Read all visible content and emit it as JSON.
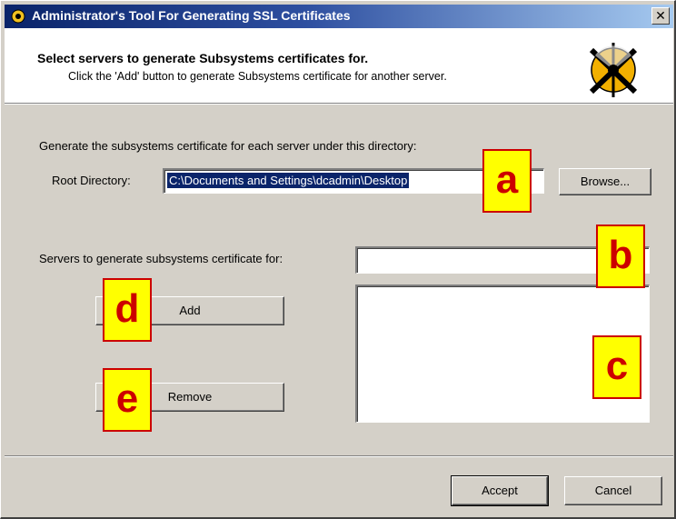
{
  "window": {
    "title": "Administrator's Tool For Generating SSL Certificates",
    "close_glyph": "✕"
  },
  "header": {
    "title": "Select servers to generate Subsystems certificates for.",
    "subtitle": "Click the 'Add' button to generate Subsystems certificate for another server."
  },
  "form": {
    "directory_instruction": "Generate the subsystems certificate for each server under this directory:",
    "root_directory_label": "Root Directory:",
    "root_directory_value": "C:\\Documents and Settings\\dcadmin\\Desktop",
    "browse_label": "Browse...",
    "servers_label": "Servers to generate subsystems certificate for:",
    "server_name_value": "",
    "add_label": "Add",
    "remove_label": "Remove",
    "servers_list": []
  },
  "footer": {
    "accept_label": "Accept",
    "cancel_label": "Cancel"
  },
  "callouts": {
    "a": "a",
    "b": "b",
    "c": "c",
    "d": "d",
    "e": "e"
  },
  "colors": {
    "callout_fill": "#ffff00",
    "callout_border": "#cc0000",
    "selection": "#0a246a",
    "dialog_face": "#d4d0c8"
  }
}
